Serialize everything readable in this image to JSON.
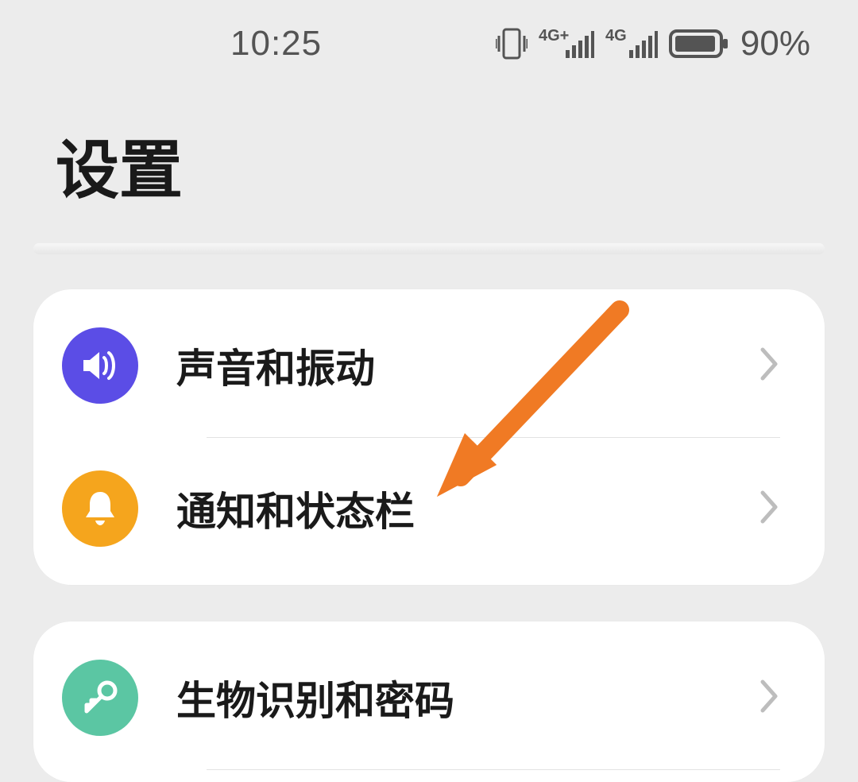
{
  "status": {
    "time": "10:25",
    "battery_pct": "90%",
    "network1": "4G+",
    "network2": "4G"
  },
  "header": {
    "title": "设置"
  },
  "group1": {
    "items": [
      {
        "icon": "volume-icon",
        "label": "声音和振动",
        "color": "#5b4de6"
      },
      {
        "icon": "bell-icon",
        "label": "通知和状态栏",
        "color": "#f5a51d"
      }
    ]
  },
  "group2": {
    "items": [
      {
        "icon": "key-icon",
        "label": "生物识别和密码",
        "color": "#5bc6a3"
      }
    ]
  },
  "annotation": {
    "arrow_color": "#f07a24"
  }
}
